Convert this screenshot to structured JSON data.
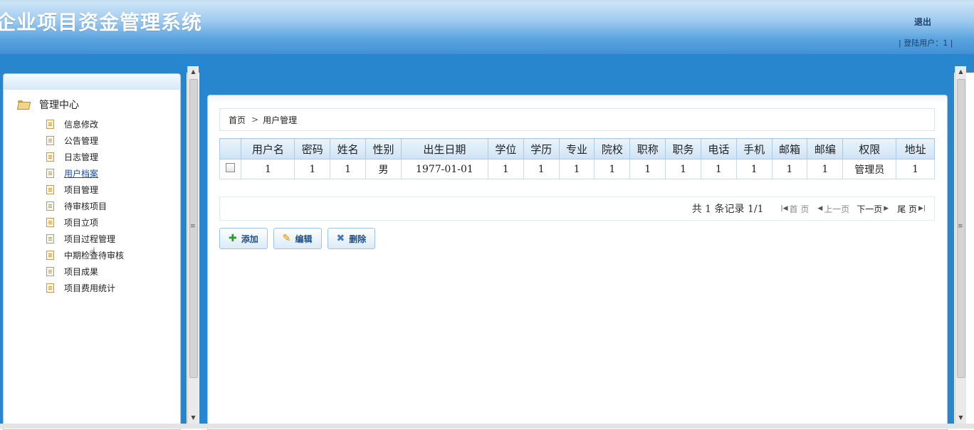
{
  "header": {
    "title": "企业项目资金管理系统",
    "logout_label": "退出",
    "login_user": "| 登陆用户：1 |"
  },
  "sidebar": {
    "root_label": "管理中心",
    "items": [
      {
        "label": "信息修改"
      },
      {
        "label": "公告管理"
      },
      {
        "label": "日志管理"
      },
      {
        "label": "用户档案"
      },
      {
        "label": "项目管理"
      },
      {
        "label": "待审核项目"
      },
      {
        "label": "项目立项"
      },
      {
        "label": "项目过程管理"
      },
      {
        "label": "中期检查待审核"
      },
      {
        "label": "项目成果"
      },
      {
        "label": "项目费用统计"
      }
    ],
    "active_index": 3
  },
  "breadcrumb": {
    "home": "首页",
    "separator": ">",
    "current": "用户管理"
  },
  "table": {
    "headers": [
      "用户名",
      "密码",
      "姓名",
      "性别",
      "出生日期",
      "学位",
      "学历",
      "专业",
      "院校",
      "职称",
      "职务",
      "电话",
      "手机",
      "邮箱",
      "邮编",
      "权限",
      "地址"
    ],
    "rows": [
      [
        "1",
        "1",
        "1",
        "男",
        "1977-01-01",
        "1",
        "1",
        "1",
        "1",
        "1",
        "1",
        "1",
        "1",
        "1",
        "1",
        "管理员",
        "1"
      ]
    ]
  },
  "pager": {
    "info": "共 1 条记录 1/1",
    "first": "首 页",
    "prev": "上一页",
    "next": "下一页",
    "last": "尾 页"
  },
  "buttons": {
    "add": "添加",
    "edit": "编辑",
    "delete": "删除"
  },
  "colors": {
    "accent_blue": "#2886cf",
    "header_top": "#cfe6f8",
    "link": "#1a4f9a"
  }
}
